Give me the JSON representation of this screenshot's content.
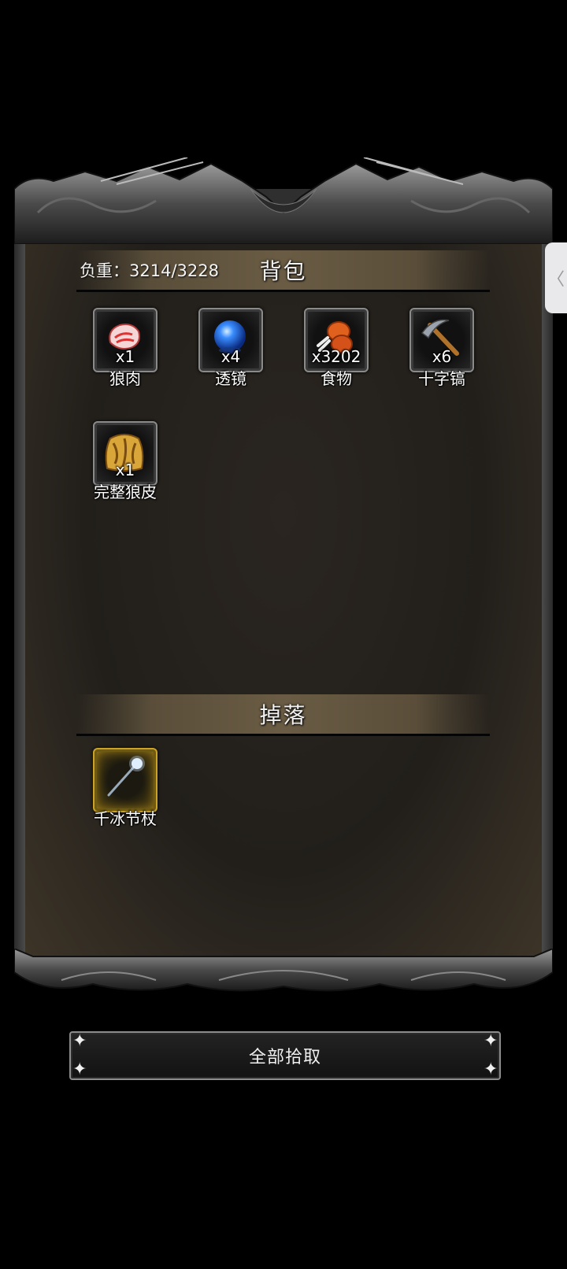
{
  "weight": {
    "label": "负重：",
    "value": "3214/3228"
  },
  "backpack": {
    "title": "背包",
    "items": [
      {
        "name": "狼肉",
        "count": "x1",
        "icon": "raw-meat-icon"
      },
      {
        "name": "透镜",
        "count": "x4",
        "icon": "blue-orb-icon"
      },
      {
        "name": "食物",
        "count": "x3202",
        "icon": "roast-drumstick-icon"
      },
      {
        "name": "十字镐",
        "count": "x6",
        "icon": "pickaxe-icon"
      },
      {
        "name": "完整狼皮",
        "count": "x1",
        "icon": "wolf-pelt-icon"
      }
    ]
  },
  "drops": {
    "title": "掉落",
    "items": [
      {
        "name": "千冰节杖",
        "count": "",
        "icon": "ice-scepter-icon",
        "rarity_color": "#c9a227"
      }
    ]
  },
  "pickup_button": {
    "label": "全部拾取"
  },
  "side_handle": {
    "glyph": "〈"
  }
}
